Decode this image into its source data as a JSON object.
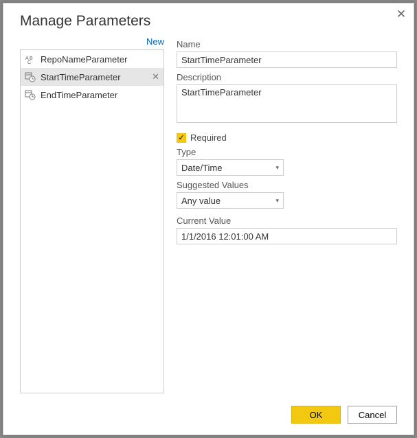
{
  "dialog": {
    "title": "Manage Parameters",
    "newLink": "New",
    "closeGlyph": "✕"
  },
  "params": {
    "items": [
      {
        "name": "RepoNameParameter",
        "icon": "abc",
        "selected": false
      },
      {
        "name": "StartTimeParameter",
        "icon": "datetime",
        "selected": true
      },
      {
        "name": "EndTimeParameter",
        "icon": "datetime",
        "selected": false
      }
    ]
  },
  "form": {
    "nameLabel": "Name",
    "nameValue": "StartTimeParameter",
    "descLabel": "Description",
    "descValue": "StartTimeParameter",
    "requiredLabel": "Required",
    "requiredChecked": true,
    "typeLabel": "Type",
    "typeValue": "Date/Time",
    "suggestedLabel": "Suggested Values",
    "suggestedValue": "Any value",
    "currentLabel": "Current Value",
    "currentValue": "1/1/2016 12:01:00 AM"
  },
  "buttons": {
    "ok": "OK",
    "cancel": "Cancel"
  }
}
